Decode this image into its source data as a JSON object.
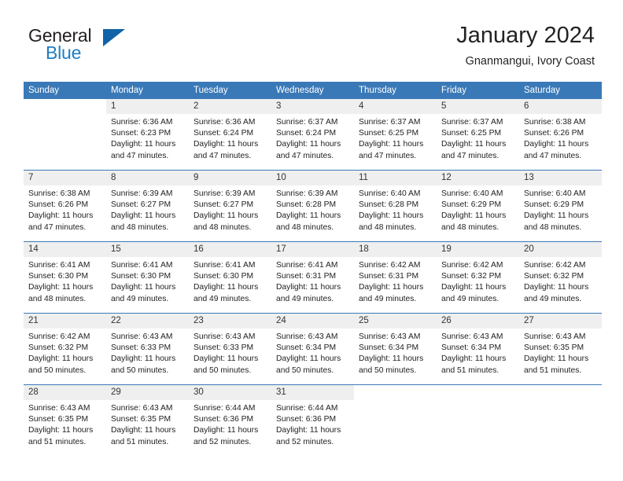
{
  "brand": {
    "line1": "General",
    "line2": "Blue",
    "triangle_color": "#1163a8",
    "blue_color": "#1f7dc4"
  },
  "header": {
    "title": "January 2024",
    "subtitle": "Gnanmangui, Ivory Coast",
    "accent_color": "#3a79b8",
    "daynum_band_color": "#efefef"
  },
  "calendar": {
    "weekday_headers": [
      "Sunday",
      "Monday",
      "Tuesday",
      "Wednesday",
      "Thursday",
      "Friday",
      "Saturday"
    ],
    "labels": {
      "sunrise": "Sunrise:",
      "sunset": "Sunset:",
      "daylight": "Daylight:"
    },
    "weeks": [
      [
        {
          "day": "",
          "empty": true
        },
        {
          "day": "1",
          "sunrise": "Sunrise: 6:36 AM",
          "sunset": "Sunset: 6:23 PM",
          "daylight": "Daylight: 11 hours and 47 minutes."
        },
        {
          "day": "2",
          "sunrise": "Sunrise: 6:36 AM",
          "sunset": "Sunset: 6:24 PM",
          "daylight": "Daylight: 11 hours and 47 minutes."
        },
        {
          "day": "3",
          "sunrise": "Sunrise: 6:37 AM",
          "sunset": "Sunset: 6:24 PM",
          "daylight": "Daylight: 11 hours and 47 minutes."
        },
        {
          "day": "4",
          "sunrise": "Sunrise: 6:37 AM",
          "sunset": "Sunset: 6:25 PM",
          "daylight": "Daylight: 11 hours and 47 minutes."
        },
        {
          "day": "5",
          "sunrise": "Sunrise: 6:37 AM",
          "sunset": "Sunset: 6:25 PM",
          "daylight": "Daylight: 11 hours and 47 minutes."
        },
        {
          "day": "6",
          "sunrise": "Sunrise: 6:38 AM",
          "sunset": "Sunset: 6:26 PM",
          "daylight": "Daylight: 11 hours and 47 minutes."
        }
      ],
      [
        {
          "day": "7",
          "sunrise": "Sunrise: 6:38 AM",
          "sunset": "Sunset: 6:26 PM",
          "daylight": "Daylight: 11 hours and 47 minutes."
        },
        {
          "day": "8",
          "sunrise": "Sunrise: 6:39 AM",
          "sunset": "Sunset: 6:27 PM",
          "daylight": "Daylight: 11 hours and 48 minutes."
        },
        {
          "day": "9",
          "sunrise": "Sunrise: 6:39 AM",
          "sunset": "Sunset: 6:27 PM",
          "daylight": "Daylight: 11 hours and 48 minutes."
        },
        {
          "day": "10",
          "sunrise": "Sunrise: 6:39 AM",
          "sunset": "Sunset: 6:28 PM",
          "daylight": "Daylight: 11 hours and 48 minutes."
        },
        {
          "day": "11",
          "sunrise": "Sunrise: 6:40 AM",
          "sunset": "Sunset: 6:28 PM",
          "daylight": "Daylight: 11 hours and 48 minutes."
        },
        {
          "day": "12",
          "sunrise": "Sunrise: 6:40 AM",
          "sunset": "Sunset: 6:29 PM",
          "daylight": "Daylight: 11 hours and 48 minutes."
        },
        {
          "day": "13",
          "sunrise": "Sunrise: 6:40 AM",
          "sunset": "Sunset: 6:29 PM",
          "daylight": "Daylight: 11 hours and 48 minutes."
        }
      ],
      [
        {
          "day": "14",
          "sunrise": "Sunrise: 6:41 AM",
          "sunset": "Sunset: 6:30 PM",
          "daylight": "Daylight: 11 hours and 48 minutes."
        },
        {
          "day": "15",
          "sunrise": "Sunrise: 6:41 AM",
          "sunset": "Sunset: 6:30 PM",
          "daylight": "Daylight: 11 hours and 49 minutes."
        },
        {
          "day": "16",
          "sunrise": "Sunrise: 6:41 AM",
          "sunset": "Sunset: 6:30 PM",
          "daylight": "Daylight: 11 hours and 49 minutes."
        },
        {
          "day": "17",
          "sunrise": "Sunrise: 6:41 AM",
          "sunset": "Sunset: 6:31 PM",
          "daylight": "Daylight: 11 hours and 49 minutes."
        },
        {
          "day": "18",
          "sunrise": "Sunrise: 6:42 AM",
          "sunset": "Sunset: 6:31 PM",
          "daylight": "Daylight: 11 hours and 49 minutes."
        },
        {
          "day": "19",
          "sunrise": "Sunrise: 6:42 AM",
          "sunset": "Sunset: 6:32 PM",
          "daylight": "Daylight: 11 hours and 49 minutes."
        },
        {
          "day": "20",
          "sunrise": "Sunrise: 6:42 AM",
          "sunset": "Sunset: 6:32 PM",
          "daylight": "Daylight: 11 hours and 49 minutes."
        }
      ],
      [
        {
          "day": "21",
          "sunrise": "Sunrise: 6:42 AM",
          "sunset": "Sunset: 6:32 PM",
          "daylight": "Daylight: 11 hours and 50 minutes."
        },
        {
          "day": "22",
          "sunrise": "Sunrise: 6:43 AM",
          "sunset": "Sunset: 6:33 PM",
          "daylight": "Daylight: 11 hours and 50 minutes."
        },
        {
          "day": "23",
          "sunrise": "Sunrise: 6:43 AM",
          "sunset": "Sunset: 6:33 PM",
          "daylight": "Daylight: 11 hours and 50 minutes."
        },
        {
          "day": "24",
          "sunrise": "Sunrise: 6:43 AM",
          "sunset": "Sunset: 6:34 PM",
          "daylight": "Daylight: 11 hours and 50 minutes."
        },
        {
          "day": "25",
          "sunrise": "Sunrise: 6:43 AM",
          "sunset": "Sunset: 6:34 PM",
          "daylight": "Daylight: 11 hours and 50 minutes."
        },
        {
          "day": "26",
          "sunrise": "Sunrise: 6:43 AM",
          "sunset": "Sunset: 6:34 PM",
          "daylight": "Daylight: 11 hours and 51 minutes."
        },
        {
          "day": "27",
          "sunrise": "Sunrise: 6:43 AM",
          "sunset": "Sunset: 6:35 PM",
          "daylight": "Daylight: 11 hours and 51 minutes."
        }
      ],
      [
        {
          "day": "28",
          "sunrise": "Sunrise: 6:43 AM",
          "sunset": "Sunset: 6:35 PM",
          "daylight": "Daylight: 11 hours and 51 minutes."
        },
        {
          "day": "29",
          "sunrise": "Sunrise: 6:43 AM",
          "sunset": "Sunset: 6:35 PM",
          "daylight": "Daylight: 11 hours and 51 minutes."
        },
        {
          "day": "30",
          "sunrise": "Sunrise: 6:44 AM",
          "sunset": "Sunset: 6:36 PM",
          "daylight": "Daylight: 11 hours and 52 minutes."
        },
        {
          "day": "31",
          "sunrise": "Sunrise: 6:44 AM",
          "sunset": "Sunset: 6:36 PM",
          "daylight": "Daylight: 11 hours and 52 minutes."
        },
        {
          "day": "",
          "empty": true
        },
        {
          "day": "",
          "empty": true
        },
        {
          "day": "",
          "empty": true
        }
      ]
    ]
  }
}
